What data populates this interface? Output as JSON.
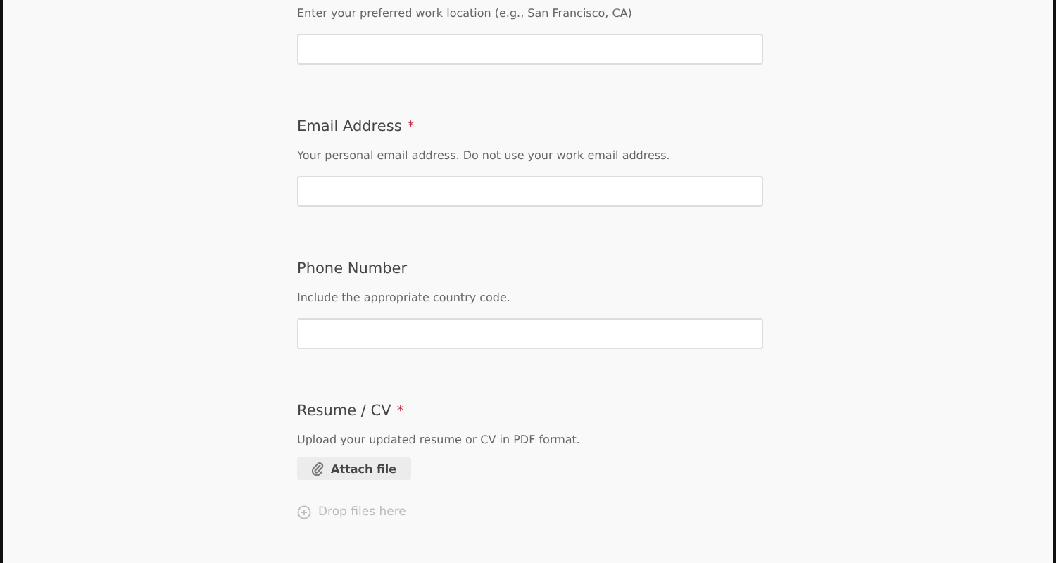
{
  "fields": [
    {
      "kind": "text",
      "description": "Enter your preferred work location (e.g., San Francisco, CA)"
    },
    {
      "kind": "text",
      "label": "Email Address",
      "required_marker": "*",
      "description": "Your personal email address. Do not use your work email address."
    },
    {
      "kind": "text",
      "label": "Phone Number",
      "description": "Include the appropriate country code."
    },
    {
      "kind": "file",
      "label": "Resume / CV",
      "required_marker": "*",
      "description": "Upload your updated resume or CV in PDF format.",
      "button": "Attach file",
      "drop_hint": "Drop files here"
    }
  ]
}
